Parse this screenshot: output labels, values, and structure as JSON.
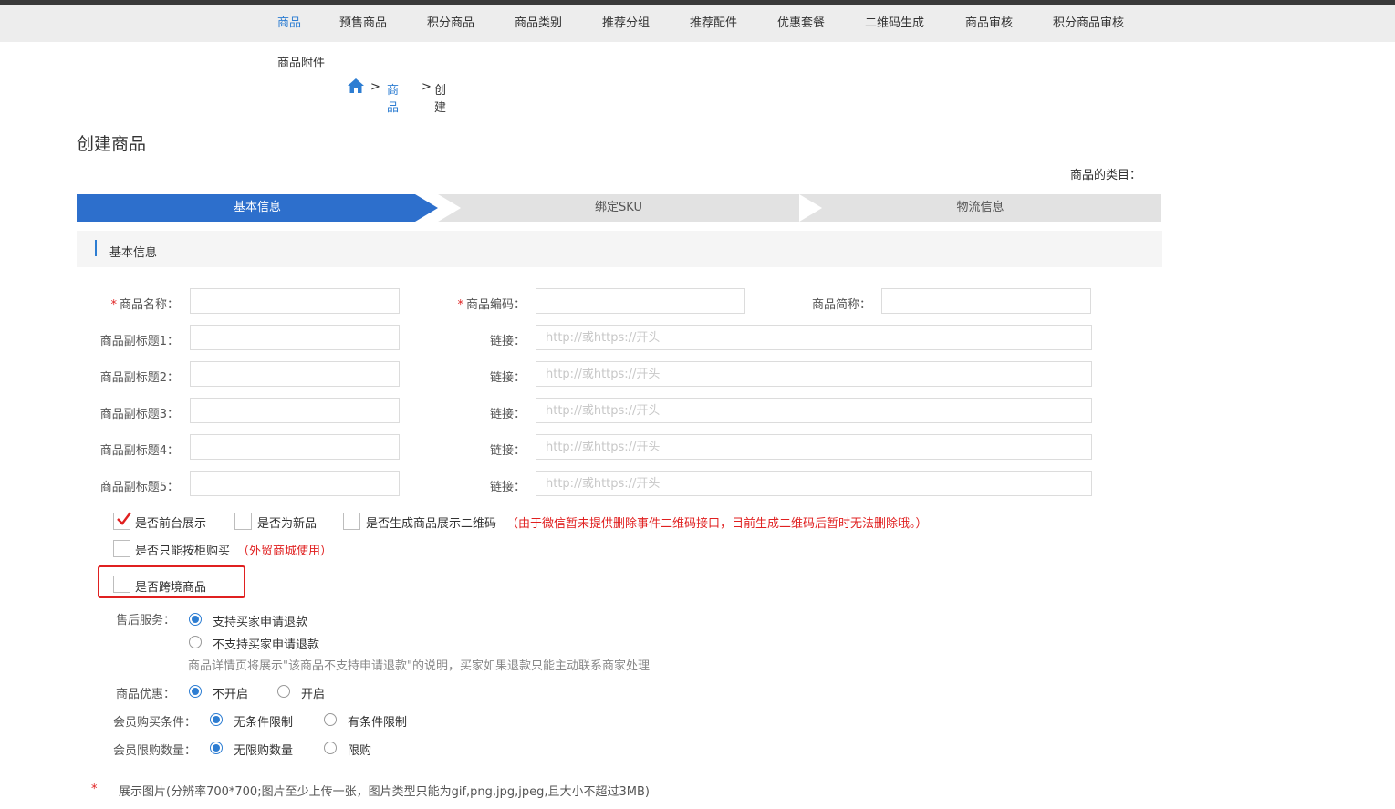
{
  "nav": {
    "items": [
      {
        "label": "商品",
        "active": true
      },
      {
        "label": "预售商品"
      },
      {
        "label": "积分商品"
      },
      {
        "label": "商品类别"
      },
      {
        "label": "推荐分组"
      },
      {
        "label": "推荐配件"
      },
      {
        "label": "优惠套餐"
      },
      {
        "label": "二维码生成"
      },
      {
        "label": "商品审核"
      },
      {
        "label": "积分商品审核"
      }
    ],
    "second_row": "商品附件"
  },
  "breadcrumb": {
    "home_icon": "home-icon",
    "sep": ">",
    "link": "商品",
    "current": "创建"
  },
  "page": {
    "title": "创建商品",
    "category_label": "商品的类目："
  },
  "steps": [
    "基本信息",
    "绑定SKU",
    "物流信息"
  ],
  "section": {
    "title": "基本信息"
  },
  "form": {
    "required_mark": "*",
    "name_label": "商品名称：",
    "code_label": "商品编码：",
    "short_label": "商品简称：",
    "link_label": "链接：",
    "link_placeholder": "http://或https://开头",
    "subtitles": [
      "商品副标题1：",
      "商品副标题2：",
      "商品副标题3：",
      "商品副标题4：",
      "商品副标题5："
    ]
  },
  "checkboxes": {
    "frontend": {
      "label": "是否前台展示",
      "checked": true
    },
    "new_item": {
      "label": "是否为新品",
      "checked": false
    },
    "qrcode": {
      "label": "是否生成商品展示二维码",
      "checked": false
    },
    "qrcode_note": "（由于微信暂未提供删除事件二维码接口，目前生成二维码后暂时无法删除哦。）",
    "counter": {
      "label": "是否只能按柜购买",
      "checked": false
    },
    "counter_note": "（外贸商城使用）",
    "crossborder": {
      "label": "是否跨境商品",
      "checked": false
    }
  },
  "after_sale": {
    "label": "售后服务：",
    "opt1": "支持买家申请退款",
    "opt2": "不支持买家申请退款",
    "note": "商品详情页将展示\"该商品不支持申请退款\"的说明，买家如果退款只能主动联系商家处理"
  },
  "discount": {
    "label": "商品优惠：",
    "off": "不开启",
    "on": "开启"
  },
  "member_condition": {
    "label": "会员购买条件：",
    "none": "无条件限制",
    "has": "有条件限制"
  },
  "member_limit": {
    "label": "会员限购数量：",
    "none": "无限购数量",
    "limit": "限购"
  },
  "images": {
    "required_mark": "*",
    "label": "展示图片(分辨率700*700;图片至少上传一张，图片类型只能为gif,png,jpg,jpeg,且大小不超过3MB)"
  },
  "colors": {
    "accent": "#2d7dd2",
    "required": "#e02020",
    "highlight": "#e02020"
  }
}
